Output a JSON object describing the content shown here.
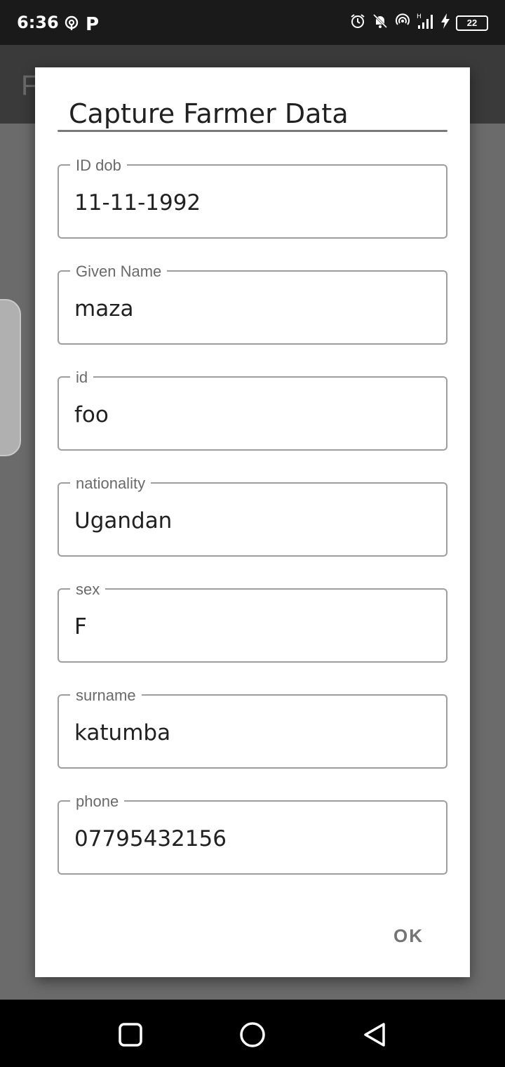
{
  "status_bar": {
    "time": "6:36",
    "p_label": "P",
    "battery": "22",
    "icons": [
      "location-icon",
      "parking-icon",
      "alarm-icon",
      "mute-bell-icon",
      "hotspot-icon",
      "signal-icon",
      "charging-icon",
      "battery-icon"
    ]
  },
  "dialog": {
    "title": "Capture Farmer Data",
    "fields": [
      {
        "label": "ID dob",
        "value": "11-11-1992"
      },
      {
        "label": "Given Name",
        "value": "maza"
      },
      {
        "label": "id",
        "value": "foo"
      },
      {
        "label": "nationality",
        "value": "Ugandan"
      },
      {
        "label": "sex",
        "value": "F"
      },
      {
        "label": "surname",
        "value": "katumba"
      },
      {
        "label": "phone",
        "value": "07795432156"
      }
    ],
    "ok_label": "OK"
  },
  "nav_bar": {
    "buttons": [
      "recents-button",
      "home-button",
      "back-button"
    ]
  },
  "colors": {
    "scrim": "#5f5f5f",
    "dialog_bg": "#ffffff",
    "field_border": "#9e9e9e",
    "button_text": "#757575"
  }
}
